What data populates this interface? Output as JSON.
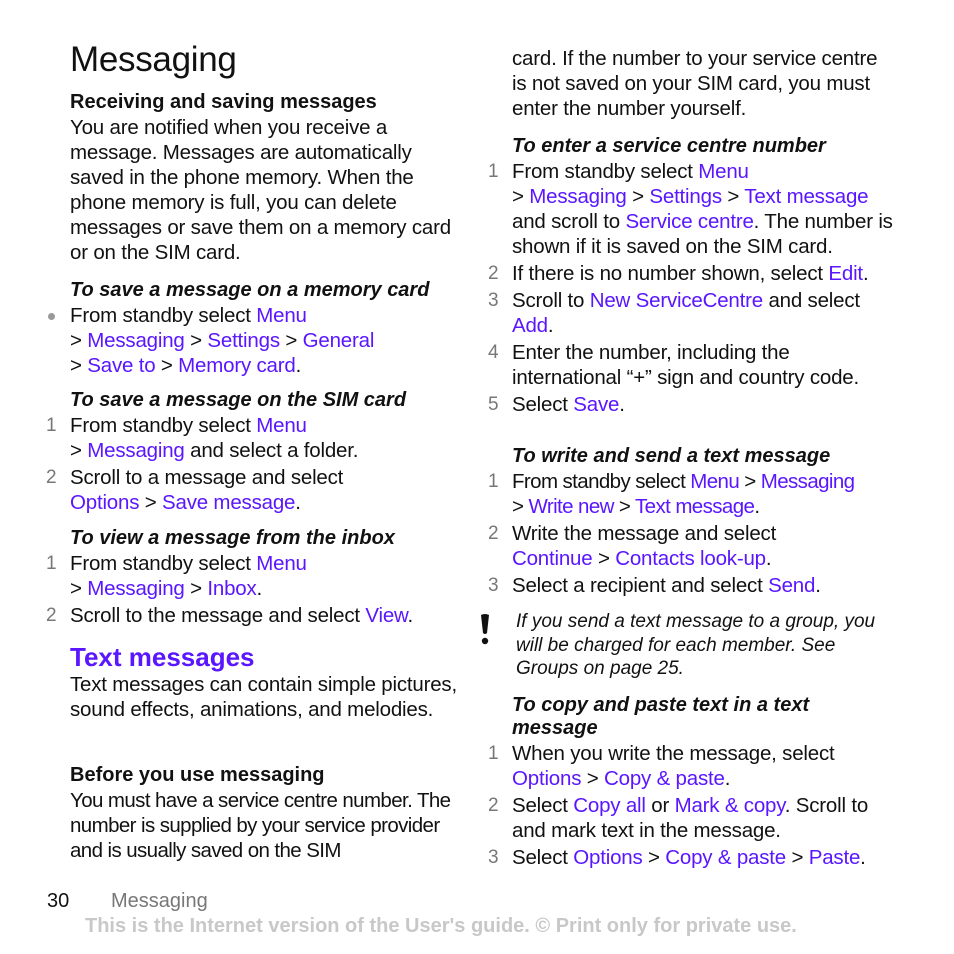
{
  "page": {
    "title": "Messaging",
    "page_number": "30",
    "footer_section": "Messaging",
    "footer_note": "This is the Internet version of the User's guide. © Print only for private use."
  },
  "colors": {
    "link": "#5a16ff",
    "heading_accent": "#5a16ff",
    "step_number": "#777777",
    "footer_note": "#c8c8c8"
  },
  "left": {
    "receiving": {
      "heading": "Receiving and saving messages",
      "body": "You are notified when you receive a message. Messages are automatically saved in the phone memory. When the phone memory is full, you can delete messages or save them on a memory card or on the SIM card."
    },
    "save_memory_card": {
      "heading": "To save a message on a memory card",
      "step1": {
        "t1": "From standby select ",
        "l1": "Menu",
        "t2": " > ",
        "l2": "Messaging",
        "t3": " > ",
        "l3": "Settings",
        "t4": " > ",
        "l4": "General",
        "t5": " > ",
        "l5": "Save to",
        "t6": " > ",
        "l6": "Memory card",
        "t7": "."
      }
    },
    "save_sim": {
      "heading": "To save a message on the SIM card",
      "step1": {
        "num": "1",
        "t1": "From standby select ",
        "l1": "Menu",
        "t2": " > ",
        "l2": "Messaging",
        "t3": " and select a folder."
      },
      "step2": {
        "num": "2",
        "t1": "Scroll to a message and select ",
        "l1": "Options",
        "t2": " > ",
        "l2": "Save message",
        "t3": "."
      }
    },
    "view_inbox": {
      "heading": "To view a message from the inbox",
      "step1": {
        "num": "1",
        "t1": "From standby select ",
        "l1": "Menu",
        "t2": " > ",
        "l2": "Messaging",
        "t3": " > ",
        "l3": "Inbox",
        "t4": "."
      },
      "step2": {
        "num": "2",
        "t1": "Scroll to the message and select ",
        "l1": "View",
        "t2": "."
      }
    },
    "text_messages": {
      "heading": "Text messages",
      "body": "Text messages can contain simple pictures, sound effects, animations, and melodies."
    },
    "before_use": {
      "heading": "Before you use messaging",
      "body": "You must have a service centre number. The number is supplied by your service provider and is usually saved on the SIM"
    }
  },
  "right": {
    "before_use_cont": "card. If the number to your service centre is not saved on your SIM card, you must enter the number yourself.",
    "enter_service": {
      "heading": "To enter a service centre number",
      "step1": {
        "num": "1",
        "t1": "From standby select ",
        "l1": "Menu",
        "t2": " > ",
        "l2": "Messaging",
        "t3": " > ",
        "l3": "Settings",
        "t4": " > ",
        "l4": "Text message",
        "t5": " and scroll to ",
        "l5": "Service centre",
        "t6": ". The number is shown if it is saved on the SIM card."
      },
      "step2": {
        "num": "2",
        "t1": "If there is no number shown, select ",
        "l1": "Edit",
        "t2": "."
      },
      "step3": {
        "num": "3",
        "t1": "Scroll to ",
        "l1": "New ServiceCentre",
        "t2": " and select ",
        "l2": "Add",
        "t3": "."
      },
      "step4": {
        "num": "4",
        "t1": "Enter the number, including the international “+” sign and country code."
      },
      "step5": {
        "num": "5",
        "t1": "Select ",
        "l1": "Save",
        "t2": "."
      }
    },
    "write_send": {
      "heading": "To write and send a text message",
      "step1": {
        "num": "1",
        "t1": "From standby select ",
        "l1": "Menu",
        "t2": " > ",
        "l2": "Messaging",
        "t3": " > ",
        "l3": "Write new",
        "t4": " > ",
        "l4": "Text message",
        "t5": "."
      },
      "step2": {
        "num": "2",
        "t1": "Write the message and select ",
        "l1": "Continue",
        "t2": " > ",
        "l2": "Contacts look-up",
        "t3": "."
      },
      "step3": {
        "num": "3",
        "t1": "Select a recipient and select ",
        "l1": "Send",
        "t2": "."
      }
    },
    "note": {
      "icon": "exclamation-icon",
      "text": "If you send a text message to a group, you will be charged for each member. See Groups on page 25."
    },
    "copy_paste": {
      "heading": "To copy and paste text in a text message",
      "step1": {
        "num": "1",
        "t1": "When you write the message, select ",
        "l1": "Options",
        "t2": " > ",
        "l2": "Copy & paste",
        "t3": "."
      },
      "step2": {
        "num": "2",
        "t1": "Select ",
        "l1": "Copy all",
        "t2": " or ",
        "l2": "Mark & copy",
        "t3": ". Scroll to and mark text in the message."
      },
      "step3": {
        "num": "3",
        "t1": "Select ",
        "l1": "Options",
        "t2": " > ",
        "l2": "Copy & paste",
        "t3": " > ",
        "l3": "Paste",
        "t4": "."
      }
    }
  }
}
